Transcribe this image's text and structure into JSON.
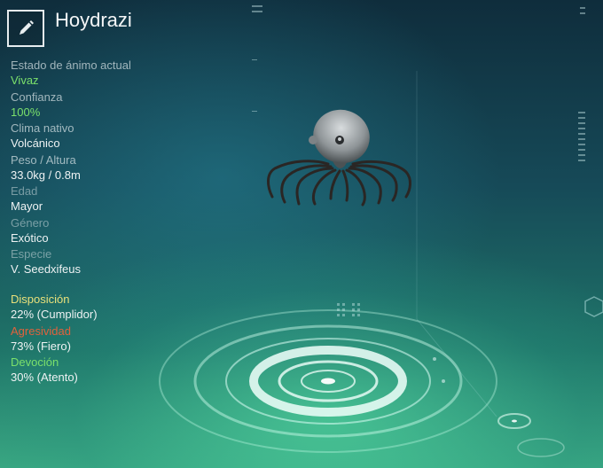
{
  "creature": {
    "name": "Hoydrazi"
  },
  "stats": [
    {
      "label": "Estado de ánimo actual",
      "value": "Vivaz",
      "value_color": "#7be06b"
    },
    {
      "label": "Confianza",
      "value": "100%",
      "value_color": "#7be06b"
    },
    {
      "label": "Clima nativo",
      "value": "Volcánico"
    },
    {
      "label": "Peso / Altura",
      "value": "33.0kg / 0.8m"
    },
    {
      "label": "Edad",
      "value": "Mayor"
    },
    {
      "label": "Género",
      "value": "Exótico"
    },
    {
      "label": "Especie",
      "value": "V. Seedxifeus"
    }
  ],
  "traits": [
    {
      "label": "Disposición",
      "value": "22% (Cumplidor)",
      "label_color": "#e8e07a"
    },
    {
      "label": "Agresividad",
      "value": "73% (Fiero)",
      "label_color": "#e0623c"
    },
    {
      "label": "Devoción",
      "value": "30% (Atento)",
      "label_color": "#7be06b"
    }
  ],
  "icons": {
    "edit": "pencil-icon"
  }
}
